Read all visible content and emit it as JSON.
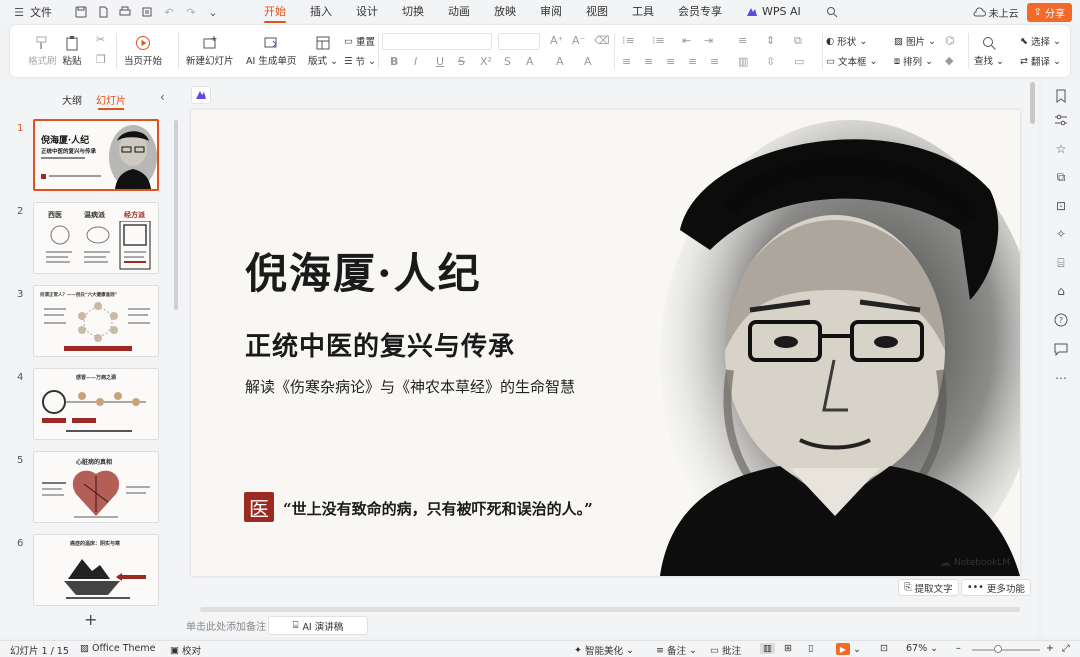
{
  "menubar": {
    "file_label": "文件",
    "tabs": [
      "开始",
      "插入",
      "设计",
      "切换",
      "动画",
      "放映",
      "审阅",
      "视图",
      "工具",
      "会员专享",
      "WPS AI"
    ],
    "active_tab": "开始",
    "cloud_label": "未上云",
    "share_label": "分享",
    "accent_color": "#e2521e"
  },
  "ribbon": {
    "format_painter": "格式刷",
    "paste": "粘贴",
    "start_from_current": "当页开始",
    "new_slide": "新建幻灯片",
    "ai_single_page": "AI 生成单页",
    "layout": "版式",
    "reset": "重置",
    "section": "节",
    "shape": "形状",
    "picture": "图片",
    "select": "选择",
    "textbox": "文本框",
    "arrange": "排列",
    "find": "查找",
    "translate": "翻译"
  },
  "left_panel": {
    "tab_outline": "大纲",
    "tab_slides": "幻灯片",
    "slide_numbers": [
      "1",
      "2",
      "3",
      "4",
      "5",
      "6"
    ],
    "active_slide": "1",
    "thumbnails": {
      "s1_title": "倪海厦·人纪",
      "s1_sub": "正统中医的复兴与传承",
      "s2_a": "西医",
      "s2_b": "温病派",
      "s2_c": "经方派",
      "s3_title": "何谓正常人？——倪氏“六大健康准则”",
      "s4_title": "感冒——万病之源",
      "s5_title": "心脏病的真相",
      "s6_title": "癌症的温床：阴实与寒"
    }
  },
  "slide": {
    "title": "倪海厦·人纪",
    "subtitle": "正统中医的复兴与传承",
    "description": "解读《伤寒杂病论》与《神农本草经》的生命智慧",
    "seal_char": "医",
    "quote": "“世上没有致命的病，只有被吓死和误治的人。”",
    "watermark": "NotebookLM"
  },
  "canvas": {
    "extract_text": "提取文字",
    "more_features": "更多功能",
    "notes_placeholder": "单击此处添加备注",
    "ai_speech": "AI 演讲稿"
  },
  "status": {
    "slide_counter": "幻灯片 1 / 15",
    "theme": "Office Theme",
    "proofread": "校对",
    "smart_beautify": "智能美化",
    "notes": "备注",
    "comments": "批注",
    "zoom": "67%"
  }
}
